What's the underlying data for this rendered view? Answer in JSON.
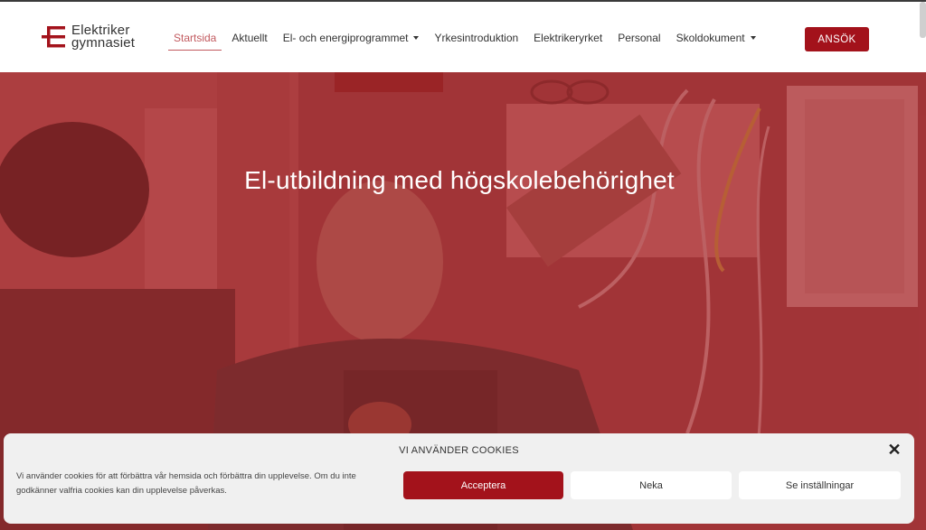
{
  "logo": {
    "line1": "Elektriker",
    "line2": "gymnasiet"
  },
  "nav": {
    "items": [
      {
        "label": "Startsida",
        "active": true,
        "dropdown": false
      },
      {
        "label": "Aktuellt",
        "active": false,
        "dropdown": false
      },
      {
        "label": "El- och energiprogrammet",
        "active": false,
        "dropdown": true
      },
      {
        "label": "Yrkesintroduktion",
        "active": false,
        "dropdown": false
      },
      {
        "label": "Elektrikeryrket",
        "active": false,
        "dropdown": false
      },
      {
        "label": "Personal",
        "active": false,
        "dropdown": false
      },
      {
        "label": "Skoldokument",
        "active": false,
        "dropdown": true
      }
    ],
    "apply_label": "ANSÖK"
  },
  "hero": {
    "title": "El-utbildning med högskolebehörighet"
  },
  "cookie": {
    "title": "VI ANVÄNDER COOKIES",
    "text": "Vi använder cookies för att förbättra vår hemsida och förbättra din upplevelse. Om du inte godkänner valfria cookies kan din upplevelse påverkas.",
    "accept_label": "Acceptera",
    "deny_label": "Neka",
    "settings_label": "Se inställningar",
    "close_icon": "close-icon"
  },
  "colors": {
    "brand": "#a3121b",
    "active_nav": "#c25a5f",
    "hero_overlay": "#a8282c"
  }
}
